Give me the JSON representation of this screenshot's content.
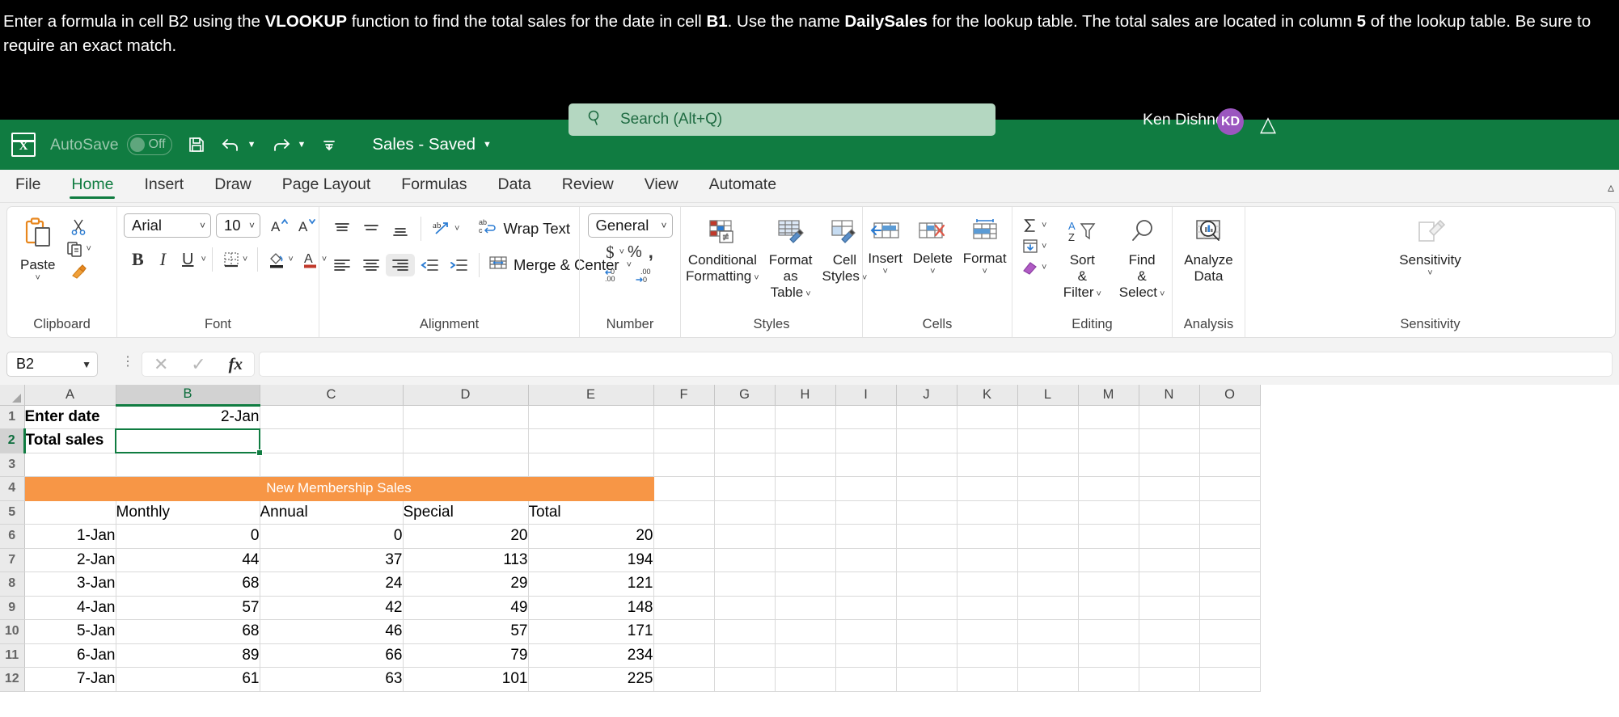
{
  "instruction": {
    "part1": "Enter a formula in cell B2 using the ",
    "bold1": "VLOOKUP",
    "part2": " function to find the total sales for the date in cell ",
    "bold2": "B1",
    "part3": ". Use the name ",
    "bold3": "DailySales",
    "part4": " for the lookup table. The total sales are located in column ",
    "bold4": "5",
    "part5": " of the lookup table. Be sure to require an exact match."
  },
  "title_bar": {
    "autosave_label": "AutoSave",
    "autosave_state": "Off",
    "save_icon": "save-icon",
    "undo_icon": "undo-icon",
    "redo_icon": "redo-icon",
    "customize_icon": "customize-quick-access-icon",
    "document_title": "Sales - Saved",
    "user_name": "Ken Dishner",
    "avatar_initials": "KD"
  },
  "search": {
    "icon": "search-icon",
    "placeholder": "Search (Alt+Q)"
  },
  "ribbon_tabs": [
    {
      "label": "File",
      "active": false
    },
    {
      "label": "Home",
      "active": true
    },
    {
      "label": "Insert",
      "active": false
    },
    {
      "label": "Draw",
      "active": false
    },
    {
      "label": "Page Layout",
      "active": false
    },
    {
      "label": "Formulas",
      "active": false
    },
    {
      "label": "Data",
      "active": false
    },
    {
      "label": "Review",
      "active": false
    },
    {
      "label": "View",
      "active": false
    },
    {
      "label": "Automate",
      "active": false
    }
  ],
  "ribbon": {
    "clipboard": {
      "label": "Clipboard",
      "paste_label": "Paste",
      "cut_label": "cut-icon",
      "copy_label": "copy-icon",
      "format_painter_label": "format-painter-icon"
    },
    "font": {
      "label": "Font",
      "font_name": "Arial",
      "font_size": "10",
      "increase_font": "A",
      "decrease_font": "A",
      "bold": "B",
      "italic": "I",
      "underline": "U",
      "borders": "borders-icon",
      "fill_color": "fill-color-icon",
      "font_color": "font-color-icon"
    },
    "alignment": {
      "label": "Alignment",
      "wrap_text": "Wrap Text",
      "merge_center": "Merge & Center",
      "top_align": "top-align-icon",
      "middle_align": "middle-align-icon",
      "bottom_align": "bottom-align-icon",
      "orientation": "orientation-icon",
      "align_left": "align-left-icon",
      "align_center": "align-center-icon",
      "align_right": "align-right-icon",
      "decrease_indent": "decrease-indent-icon",
      "increase_indent": "increase-indent-icon"
    },
    "number": {
      "label": "Number",
      "format": "General",
      "currency": "$",
      "percent": "%",
      "comma": ",",
      "increase_decimal": "increase-decimal-icon",
      "decrease_decimal": "decrease-decimal-icon"
    },
    "styles": {
      "label": "Styles",
      "conditional_formatting_l1": "Conditional",
      "conditional_formatting_l2": "Formatting",
      "format_as_table_l1": "Format",
      "format_as_table_l2": "as Table",
      "cell_styles_l1": "Cell",
      "cell_styles_l2": "Styles"
    },
    "cells": {
      "label": "Cells",
      "insert": "Insert",
      "delete": "Delete",
      "format": "Format"
    },
    "editing": {
      "label": "Editing",
      "autosum": "autosum-icon",
      "fill": "fill-icon",
      "clear": "clear-icon",
      "sort_l1": "Sort",
      "sort_l2": "& Filter",
      "find_l1": "Find",
      "find_l2": "& Select"
    },
    "analysis": {
      "label": "Analysis",
      "analyze_data_l1": "Analyze",
      "analyze_data_l2": "Data"
    },
    "sensitivity": {
      "label": "Sensitivity",
      "button": "Sensitivity"
    }
  },
  "formula_bar": {
    "name_box": "B2",
    "cancel_icon": "cancel-icon",
    "enter_icon": "confirm-icon",
    "fx_icon": "insert-function-icon",
    "formula_value": ""
  },
  "grid": {
    "columns": [
      "A",
      "B",
      "C",
      "D",
      "E",
      "F",
      "G",
      "H",
      "I",
      "J",
      "K",
      "L",
      "M",
      "N",
      "O"
    ],
    "selected_column": "B",
    "selected_row": "2",
    "active_cell": "B2",
    "rows": [
      {
        "n": "1",
        "cells": [
          {
            "v": "Enter date",
            "a": "l",
            "bold": true
          },
          {
            "v": "2-Jan",
            "a": "r"
          },
          {
            "v": "",
            "a": "l"
          },
          {
            "v": "",
            "a": "l"
          },
          {
            "v": "",
            "a": "l"
          }
        ]
      },
      {
        "n": "2",
        "cells": [
          {
            "v": "Total sales",
            "a": "l",
            "bold": true
          },
          {
            "v": "",
            "a": "r"
          },
          {
            "v": "",
            "a": "l"
          },
          {
            "v": "",
            "a": "l"
          },
          {
            "v": "",
            "a": "l"
          }
        ]
      },
      {
        "n": "3",
        "cells": [
          {
            "v": "",
            "a": "l"
          },
          {
            "v": "",
            "a": "r"
          },
          {
            "v": "",
            "a": "l"
          },
          {
            "v": "",
            "a": "l"
          },
          {
            "v": "",
            "a": "l"
          }
        ]
      },
      {
        "n": "4",
        "banner": "New Membership Sales"
      },
      {
        "n": "5",
        "cells": [
          {
            "v": "",
            "a": "l"
          },
          {
            "v": "Monthly",
            "a": "l"
          },
          {
            "v": "Annual",
            "a": "l"
          },
          {
            "v": "Special",
            "a": "l"
          },
          {
            "v": "Total",
            "a": "l"
          }
        ]
      },
      {
        "n": "6",
        "cells": [
          {
            "v": "1-Jan",
            "a": "r"
          },
          {
            "v": "0",
            "a": "r"
          },
          {
            "v": "0",
            "a": "r"
          },
          {
            "v": "20",
            "a": "r"
          },
          {
            "v": "20",
            "a": "r"
          }
        ]
      },
      {
        "n": "7",
        "cells": [
          {
            "v": "2-Jan",
            "a": "r"
          },
          {
            "v": "44",
            "a": "r"
          },
          {
            "v": "37",
            "a": "r"
          },
          {
            "v": "113",
            "a": "r"
          },
          {
            "v": "194",
            "a": "r"
          }
        ]
      },
      {
        "n": "8",
        "cells": [
          {
            "v": "3-Jan",
            "a": "r"
          },
          {
            "v": "68",
            "a": "r"
          },
          {
            "v": "24",
            "a": "r"
          },
          {
            "v": "29",
            "a": "r"
          },
          {
            "v": "121",
            "a": "r"
          }
        ]
      },
      {
        "n": "9",
        "cells": [
          {
            "v": "4-Jan",
            "a": "r"
          },
          {
            "v": "57",
            "a": "r"
          },
          {
            "v": "42",
            "a": "r"
          },
          {
            "v": "49",
            "a": "r"
          },
          {
            "v": "148",
            "a": "r"
          }
        ]
      },
      {
        "n": "10",
        "cells": [
          {
            "v": "5-Jan",
            "a": "r"
          },
          {
            "v": "68",
            "a": "r"
          },
          {
            "v": "46",
            "a": "r"
          },
          {
            "v": "57",
            "a": "r"
          },
          {
            "v": "171",
            "a": "r"
          }
        ]
      },
      {
        "n": "11",
        "cells": [
          {
            "v": "6-Jan",
            "a": "r"
          },
          {
            "v": "89",
            "a": "r"
          },
          {
            "v": "66",
            "a": "r"
          },
          {
            "v": "79",
            "a": "r"
          },
          {
            "v": "234",
            "a": "r"
          }
        ]
      },
      {
        "n": "12",
        "cells": [
          {
            "v": "7-Jan",
            "a": "r"
          },
          {
            "v": "61",
            "a": "r"
          },
          {
            "v": "63",
            "a": "r"
          },
          {
            "v": "101",
            "a": "r"
          },
          {
            "v": "225",
            "a": "r"
          }
        ]
      }
    ]
  },
  "colors": {
    "excel_green": "#107c41",
    "banner_orange": "#f79646",
    "avatar_purple": "#9b56bf"
  }
}
